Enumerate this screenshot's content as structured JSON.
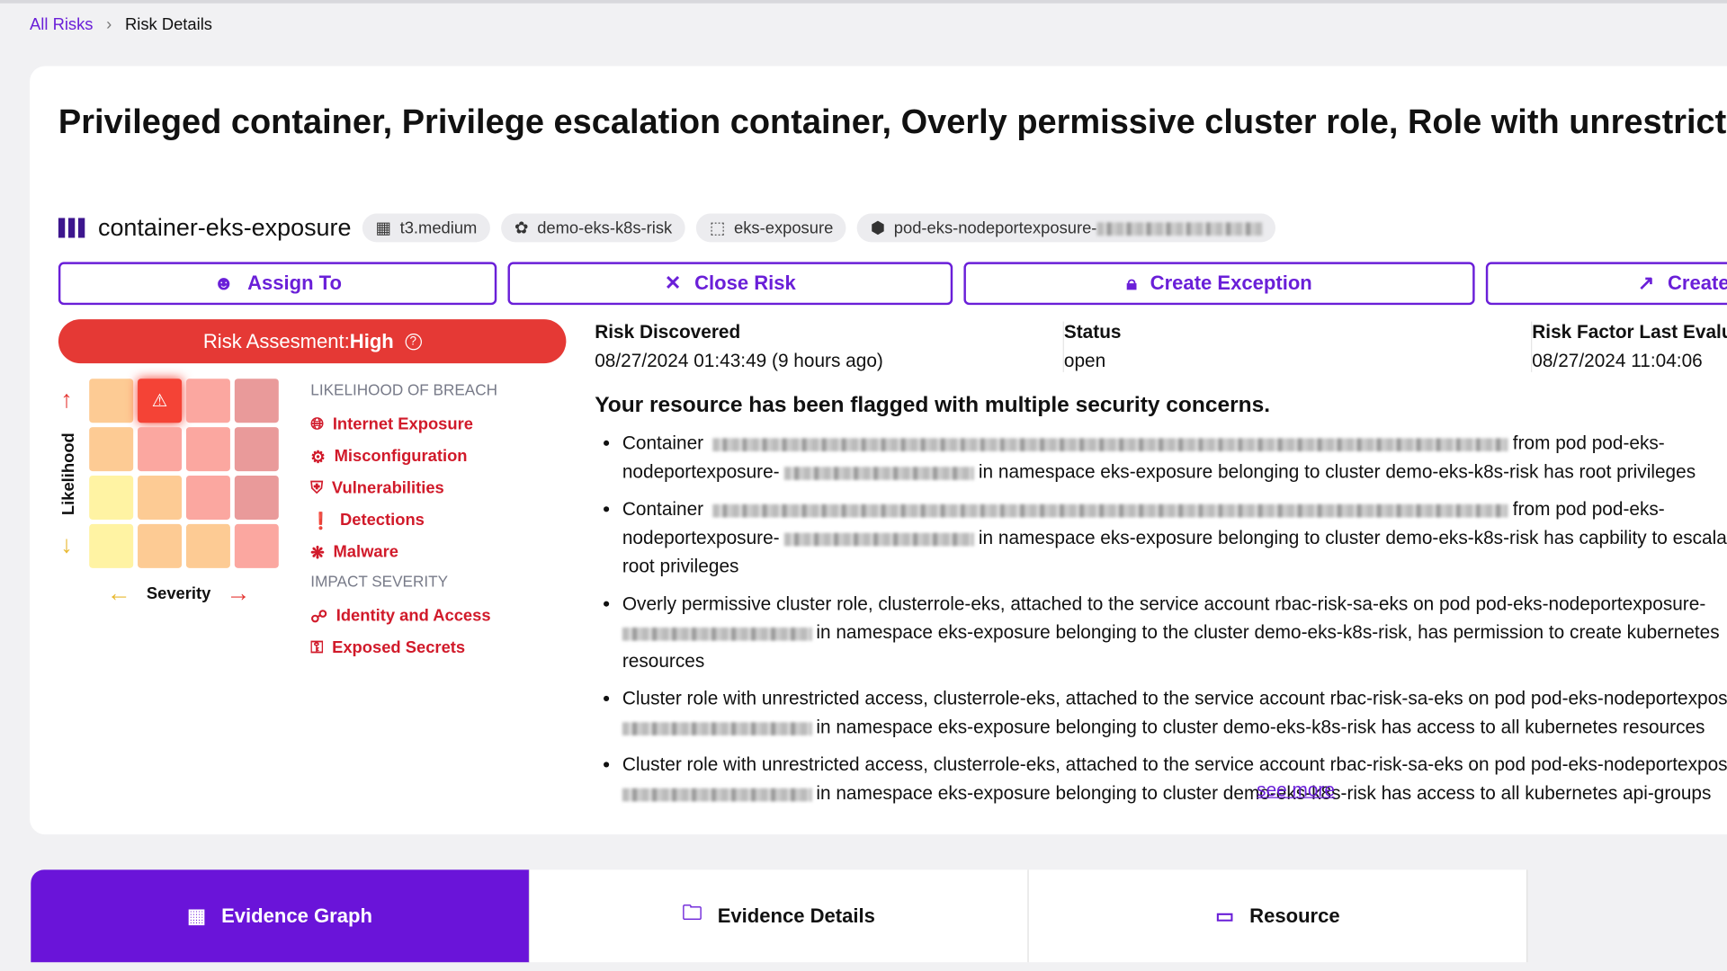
{
  "breadcrumb": {
    "parent": "All Risks",
    "current": "Risk Details"
  },
  "title": "Privileged container, Privilege escalation container, Overly permissive cluster role, Role with unrestricted access to kubernetes resources, Cluster role with unrestricted access to kubernetes api-groups, Host network access",
  "resource": {
    "name": "container-eks-exposure",
    "chips": [
      {
        "icon": "chip-icon",
        "label": "t3.medium"
      },
      {
        "icon": "cluster-icon",
        "label": "demo-eks-k8s-risk"
      },
      {
        "icon": "namespace-icon",
        "label": "eks-exposure"
      },
      {
        "icon": "pod-icon",
        "label": "pod-eks-nodeportexposure-"
      }
    ]
  },
  "actions": [
    {
      "label": "Assign To",
      "icon": "user-icon"
    },
    {
      "label": "Close Risk",
      "icon": "close-icon"
    },
    {
      "label": "Create Exception",
      "icon": "lock-icon"
    },
    {
      "label": "Create",
      "icon": "external-link-icon"
    }
  ],
  "risk": {
    "label": "Risk Assesment:",
    "level": "High",
    "color": "#e53935"
  },
  "matrix": {
    "likelihood_label": "Likelihood",
    "severity_label": "Severity",
    "colors": [
      [
        "#fdcb94",
        "#f44336",
        "#fba7a0",
        "#e99a9a"
      ],
      [
        "#fdcb94",
        "#fba7a0",
        "#fba7a0",
        "#e99a9a"
      ],
      [
        "#fff3a3",
        "#fdcb94",
        "#fba7a0",
        "#e99a9a"
      ],
      [
        "#fff3a3",
        "#fdcb94",
        "#fdcb94",
        "#fba7a0"
      ]
    ],
    "selected": [
      0,
      1
    ]
  },
  "legend": {
    "likelihood_heading": "LIKELIHOOD OF BREACH",
    "likelihood": [
      "Internet Exposure",
      "Misconfiguration",
      "Vulnerabilities",
      "Detections",
      "Malware"
    ],
    "impact_heading": "IMPACT SEVERITY",
    "impact": [
      "Identity and Access",
      "Exposed Secrets"
    ]
  },
  "meta": [
    {
      "k": "Risk Discovered",
      "v": "08/27/2024 01:43:49 (9 hours ago)"
    },
    {
      "k": "Status",
      "v": "open"
    },
    {
      "k": "Risk Factor Last Evaluated",
      "v": "08/27/2024 11:04:06"
    }
  ],
  "summary": "Your resource has been flagged with multiple security concerns.",
  "findings": [
    {
      "a": "Container",
      "b": "from pod pod-eks-nodeportexposure-",
      "c": "in namespace eks-exposure belonging to cluster demo-eks-k8s-risk has root privileges"
    },
    {
      "a": "Container",
      "b": "from pod pod-eks-nodeportexposure-",
      "c": "in namespace eks-exposure belonging to cluster demo-eks-k8s-risk has capbility to escalate root privileges"
    },
    {
      "a": "Overly permissive cluster role, clusterrole-eks, attached to the service account rbac-risk-sa-eks on pod pod-eks-nodeportexposure-",
      "b": "",
      "c": "in namespace eks-exposure belonging to the cluster demo-eks-k8s-risk, has permission to create kubernetes resources"
    },
    {
      "a": "Cluster role with unrestricted access, clusterrole-eks, attached to the service account rbac-risk-sa-eks on pod pod-eks-nodeportexposure-",
      "b": "",
      "c": "in namespace eks-exposure belonging to cluster demo-eks-k8s-risk has access to all kubernetes resources"
    },
    {
      "a": "Cluster role with unrestricted access, clusterrole-eks, attached to the service account rbac-risk-sa-eks on pod pod-eks-nodeportexposure-",
      "b": "",
      "c": "in namespace eks-exposure belonging to cluster demo-eks-k8s-risk has access to all kubernetes api-groups"
    }
  ],
  "see_more": "see more",
  "tabs": [
    {
      "label": "Evidence Graph",
      "icon": "graph-icon"
    },
    {
      "label": "Evidence Details",
      "icon": "folder-icon"
    },
    {
      "label": "Resource",
      "icon": "laptop-icon"
    }
  ],
  "accent": "#6a1fd8"
}
